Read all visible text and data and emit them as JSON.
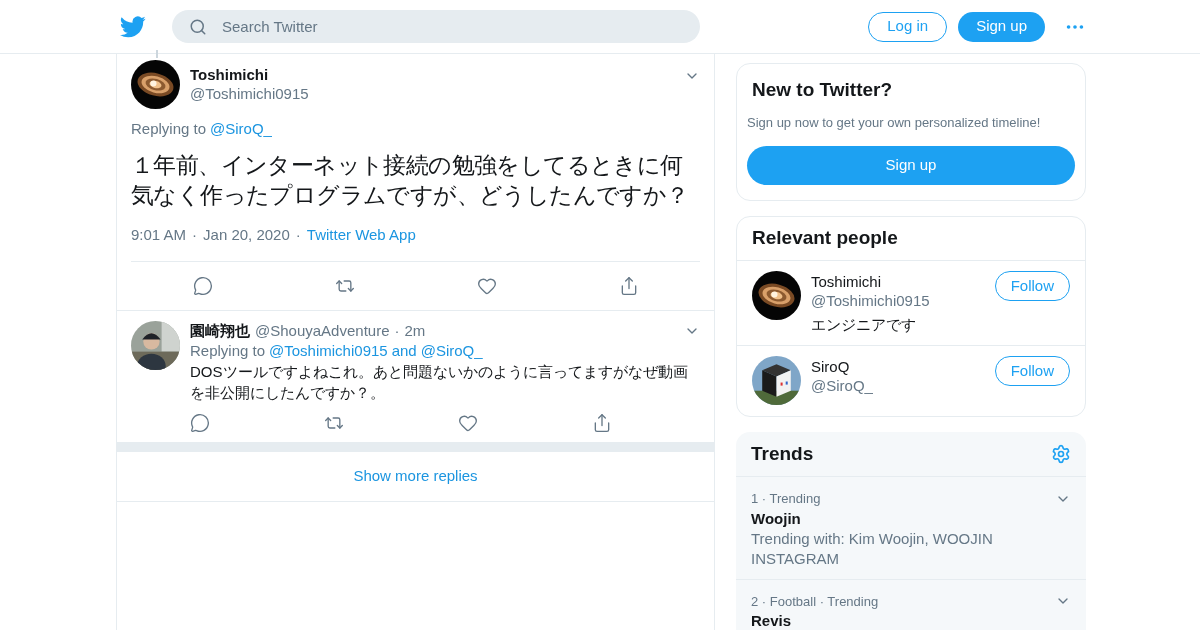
{
  "header": {
    "search": {
      "placeholder": "Search Twitter"
    },
    "buttons": [
      {
        "label": "Log in",
        "kind": "outline"
      },
      {
        "label": "Sign up",
        "kind": "filled"
      }
    ]
  },
  "tweet": {
    "name": "Toshimichi",
    "handle": "@Toshimichi0915",
    "replying_label": "Replying to",
    "replying_to": [
      "@SiroQ_"
    ],
    "text": "１年前、インターネット接続の勉強をしてるときに何気なく作ったプログラムですが、どうしたんですか？",
    "meta": [
      {
        "text": "9:01 AM",
        "kind": "plain"
      },
      {
        "text": "·",
        "kind": "plain"
      },
      {
        "text": "Jan 20, 2020",
        "kind": "plain"
      },
      {
        "text": "·",
        "kind": "plain"
      },
      {
        "text": "Twitter Web App",
        "kind": "link"
      }
    ]
  },
  "reply": {
    "name": "園崎翔也",
    "handle": "@ShouyaAdventure",
    "separator": "·",
    "time": "2m",
    "replying_label": "Replying to",
    "replying_to": [
      "@Toshimichi0915",
      "@SiroQ_"
    ],
    "joiner": "and",
    "text": "DOSツールですよねこれ。あと問題ないかのように言ってますがなぜ動画を非公開にしたんですか？。"
  },
  "show_more": "Show more replies",
  "signup_card": {
    "title": "New to Twitter?",
    "subtitle": "Sign up now to get your own personalized timeline!",
    "button": "Sign up"
  },
  "people_card": {
    "title": "Relevant people",
    "people": [
      {
        "name": "Toshimichi",
        "handle": "@Toshimichi0915",
        "bio": "エンジニアです",
        "button": "Follow"
      },
      {
        "name": "SiroQ",
        "handle": "@SiroQ_",
        "button": "Follow"
      }
    ]
  },
  "trends": {
    "title": "Trends",
    "items": [
      {
        "context": "1 · Trending",
        "name": "Woojin",
        "description": "Trending with: Kim Woojin, WOOJIN INSTAGRAM"
      },
      {
        "context": "2 · Football · Trending",
        "name": "Revis"
      }
    ]
  }
}
